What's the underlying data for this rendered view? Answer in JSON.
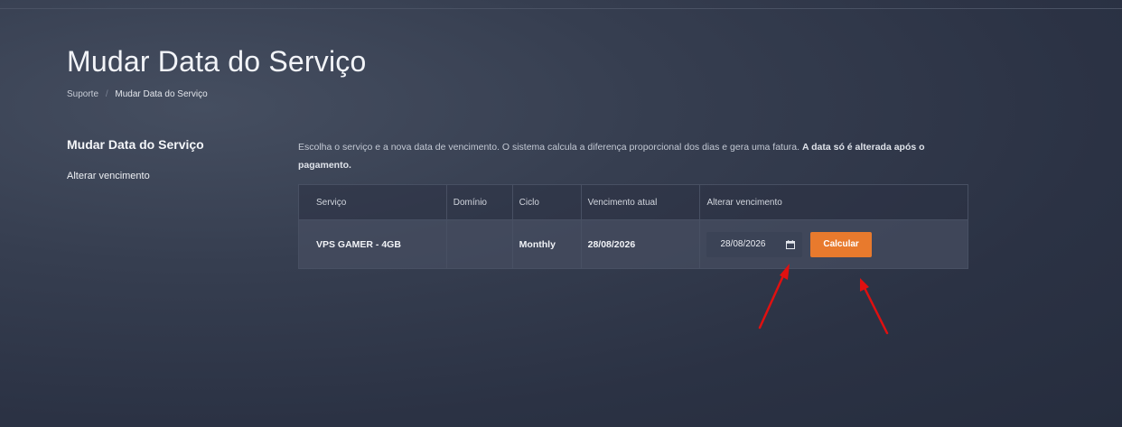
{
  "header": {
    "title": "Mudar Data do Serviço",
    "breadcrumb": {
      "items": [
        "Suporte",
        "Mudar Data do Serviço"
      ],
      "separator": "/"
    }
  },
  "sidebar": {
    "title": "Mudar Data do Serviço",
    "link": "Alterar vencimento"
  },
  "main": {
    "description_text": "Escolha o serviço e a nova data de vencimento. O sistema calcula a diferença proporcional dos dias e gera uma fatura. ",
    "description_bold": "A data só é alterada após o pagamento.",
    "table": {
      "headers": [
        "Serviço",
        "Domínio",
        "Ciclo",
        "Vencimento atual",
        "Alterar vencimento"
      ],
      "rows": [
        {
          "service": "VPS GAMER - 4GB",
          "domain": "",
          "cycle": "Monthly",
          "current_due": "28/08/2026",
          "new_due_value": "28/08/2026",
          "calc_label": "Calcular"
        }
      ]
    }
  },
  "colors": {
    "accent": "#e87a2d",
    "annotation_arrows": "#e01010"
  },
  "icons": {
    "date_picker": "calendar-icon"
  }
}
